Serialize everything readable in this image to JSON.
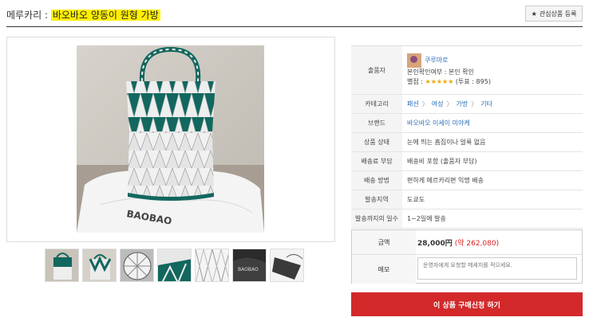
{
  "header": {
    "prefix": "메루카리 : ",
    "item_title": "바오바오 양동이 원형 가방",
    "wish_label": "관심상품 등록",
    "wish_icon": "star-icon"
  },
  "gallery": {
    "main_image": "tote-bag-photo",
    "thumbnails": [
      "bag-front",
      "bag-side",
      "bag-bottom",
      "bag-handle",
      "bag-panel",
      "bag-dustbag",
      "bag-tag"
    ]
  },
  "info": {
    "seller_label": "출품자",
    "seller_name": "쿠루마로",
    "seller_verified": "본인확인여부 : 본인 확인",
    "seller_rating_label": "별점 :",
    "seller_stars": "★★★★★",
    "seller_votes": "(투표 : 895)",
    "category_label": "카테고리",
    "category": [
      "패션",
      "여성",
      "가방",
      "기타"
    ],
    "brand_label": "브랜드",
    "brand": "바오바오 이세이 미야케",
    "condition_label": "상품 상태",
    "condition": "눈에 띄는 흠집이나 얼룩 없음",
    "shipping_fee_label": "배송료 부담",
    "shipping_fee": "배송비 포함 (출품자 부담)",
    "shipping_method_label": "배송 방법",
    "shipping_method": "편하게 메르카리편 익명 배송",
    "ship_from_label": "발송지역",
    "ship_from": "도쿄도",
    "days_label": "발송까지의 일수",
    "days": "1~2일에 발송"
  },
  "buy": {
    "price_label": "금액",
    "price": "28,000円",
    "price_krw": "(약 262,080)",
    "memo_label": "메모",
    "memo_placeholder": "운영자에게 요청할 메세지를 적으세요.",
    "buy_button": "이 상품 구매신청 하기"
  },
  "colors": {
    "highlight": "#ffef00",
    "accent_red": "#d3292b",
    "bag_green": "#12675e",
    "link_blue": "#2a6ebb"
  }
}
